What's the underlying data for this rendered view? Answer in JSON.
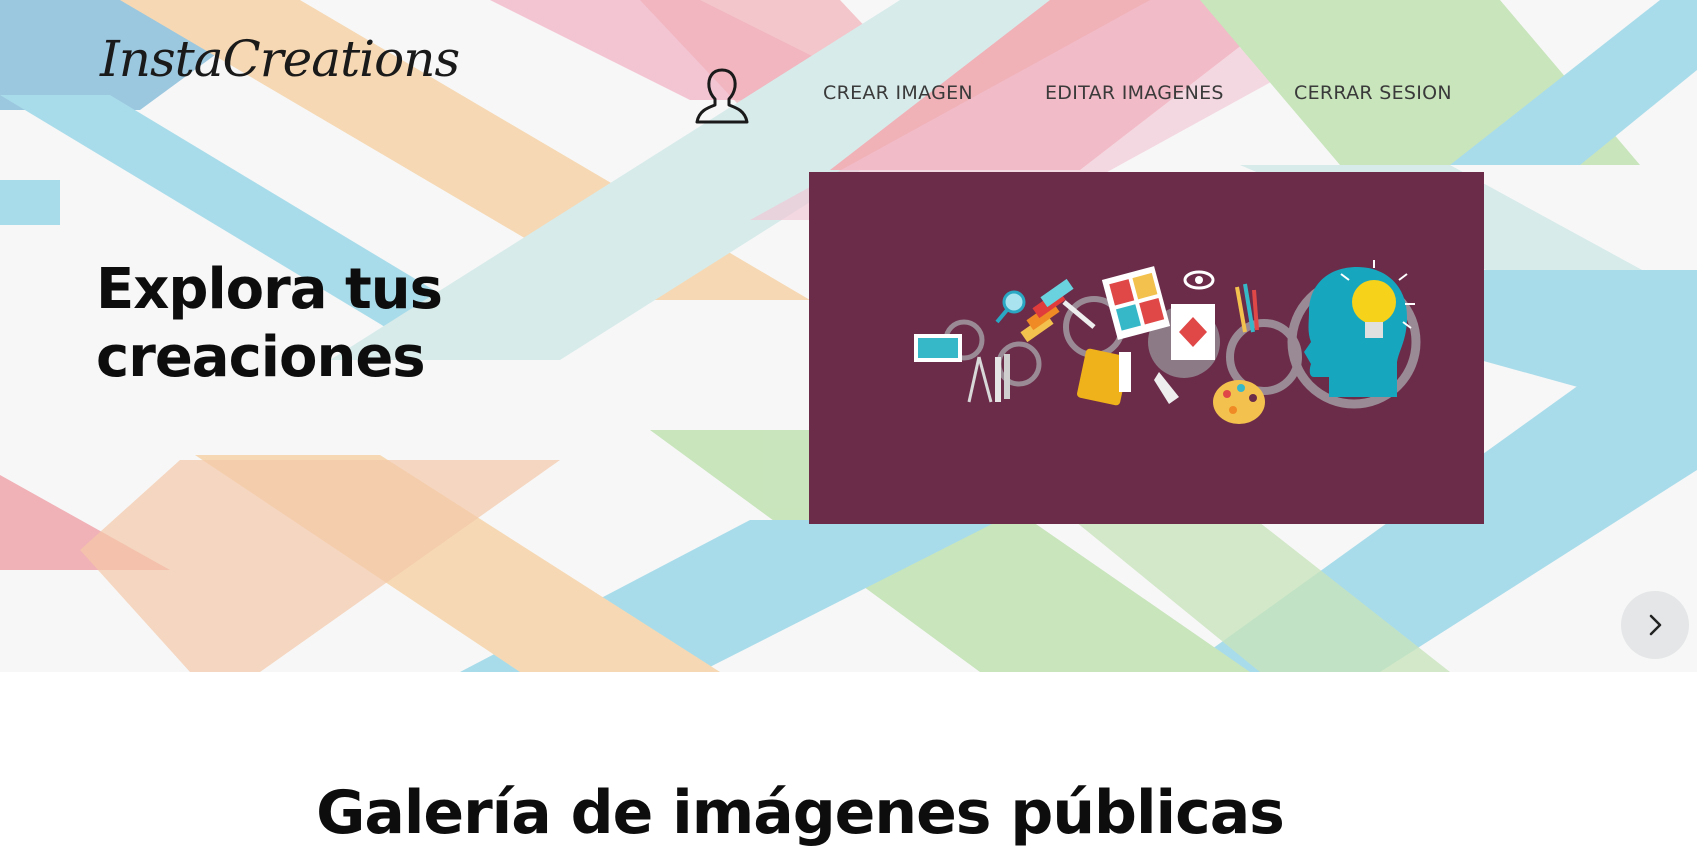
{
  "brand": {
    "logo_text": "InstaCreations"
  },
  "nav": {
    "user_icon": "user-icon",
    "links": [
      {
        "label": "CREAR IMAGEN"
      },
      {
        "label": "EDITAR IMAGENES"
      },
      {
        "label": "CERRAR SESION"
      }
    ]
  },
  "hero": {
    "headline_line1": "Explora tus",
    "headline_line2": "creaciones",
    "slide_image_bg": "#6b2c49",
    "next_icon": "chevron-right-icon"
  },
  "gallery": {
    "title": "Galería de imágenes públicas"
  },
  "colors": {
    "text_dark": "#0d0d0d",
    "nav_text": "#3a3a3a",
    "slide_bg": "#6b2c49",
    "next_button_bg": "#e4e6e7",
    "stripe_blue": "#8fd3e6",
    "stripe_orange": "#f6cf9e",
    "stripe_pink": "#f2b3c6",
    "stripe_green": "#b9dfa9",
    "stripe_red": "#ee9aa2",
    "stripe_teal": "#cde7e6"
  }
}
